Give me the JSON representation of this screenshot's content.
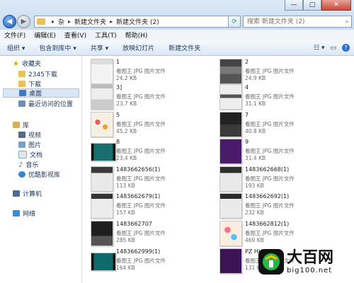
{
  "address": {
    "segments": [
      "杂",
      "新建文件夹",
      "新建文件夹 (2)"
    ]
  },
  "search": {
    "placeholder": "搜索 新建文件夹 (2)"
  },
  "window_buttons": {
    "minimize": "—",
    "maximize": "□",
    "close": "✕"
  },
  "menu": [
    "文件(F)",
    "编辑(E)",
    "查看(V)",
    "工具(T)",
    "帮助(H)"
  ],
  "toolbar": {
    "organize": "组织 ▾",
    "include": "包含到库中 ▾",
    "share": "共享 ▾",
    "slideshow": "放映幻灯片",
    "new_folder": "新建文件夹"
  },
  "sidebar": {
    "favorites": "收藏夹",
    "fav_items": [
      "2345下载",
      "下载",
      "桌面",
      "最近访问的位置"
    ],
    "libraries": "库",
    "lib_items": [
      "视频",
      "图片",
      "文档",
      "音乐",
      "优酷影视库"
    ],
    "computer": "计算机",
    "network": "网络"
  },
  "files": [
    {
      "name": "1",
      "type": "看图王 JPG 图片文件",
      "size": "24.2 KB"
    },
    {
      "name": "2",
      "type": "看图王 JPG 图片文件",
      "size": "24.9 KB"
    },
    {
      "name": "3]",
      "type": "看图王 JPG 图片文件",
      "size": "23.7 KB"
    },
    {
      "name": "4",
      "type": "看图王 JPG 图片文件",
      "size": "31.1 KB"
    },
    {
      "name": "5",
      "type": "看图王 JPG 图片文件",
      "size": "45.2 KB"
    },
    {
      "name": "7",
      "type": "看图王 JPG 图片文件",
      "size": "40.8 KB"
    },
    {
      "name": "8",
      "type": "看图王 JPG 图片文件",
      "size": "23.4 KB"
    },
    {
      "name": "9",
      "type": "看图王 JPG 图片文件",
      "size": "31.4 KB"
    },
    {
      "name": "1483662656(1)",
      "type": "看图王 JPG 图片文件",
      "size": "113 KB"
    },
    {
      "name": "1483662668(1)",
      "type": "看图王 JPG 图片文件",
      "size": "193 KB"
    },
    {
      "name": "1483662679(1)",
      "type": "看图王 JPG 图片文件",
      "size": "157 KB"
    },
    {
      "name": "1483662692(1)",
      "type": "看图王 JPG 图片文件",
      "size": "232 KB"
    },
    {
      "name": "1483662707",
      "type": "看图王 JPG 图片文件",
      "size": "285 KB"
    },
    {
      "name": "1483662812(1)",
      "type": "看图王 JPG 图片文件",
      "size": "469 KB"
    },
    {
      "name": "1483662999(1)",
      "type": "看图王 JPG 图片文件",
      "size": "164 KB"
    },
    {
      "name": "PZ HH_OP",
      "type": "看图王 JPG 图片文件",
      "size": "131 KB"
    }
  ],
  "watermark": {
    "text": "大百网",
    "url": "big100.net"
  }
}
